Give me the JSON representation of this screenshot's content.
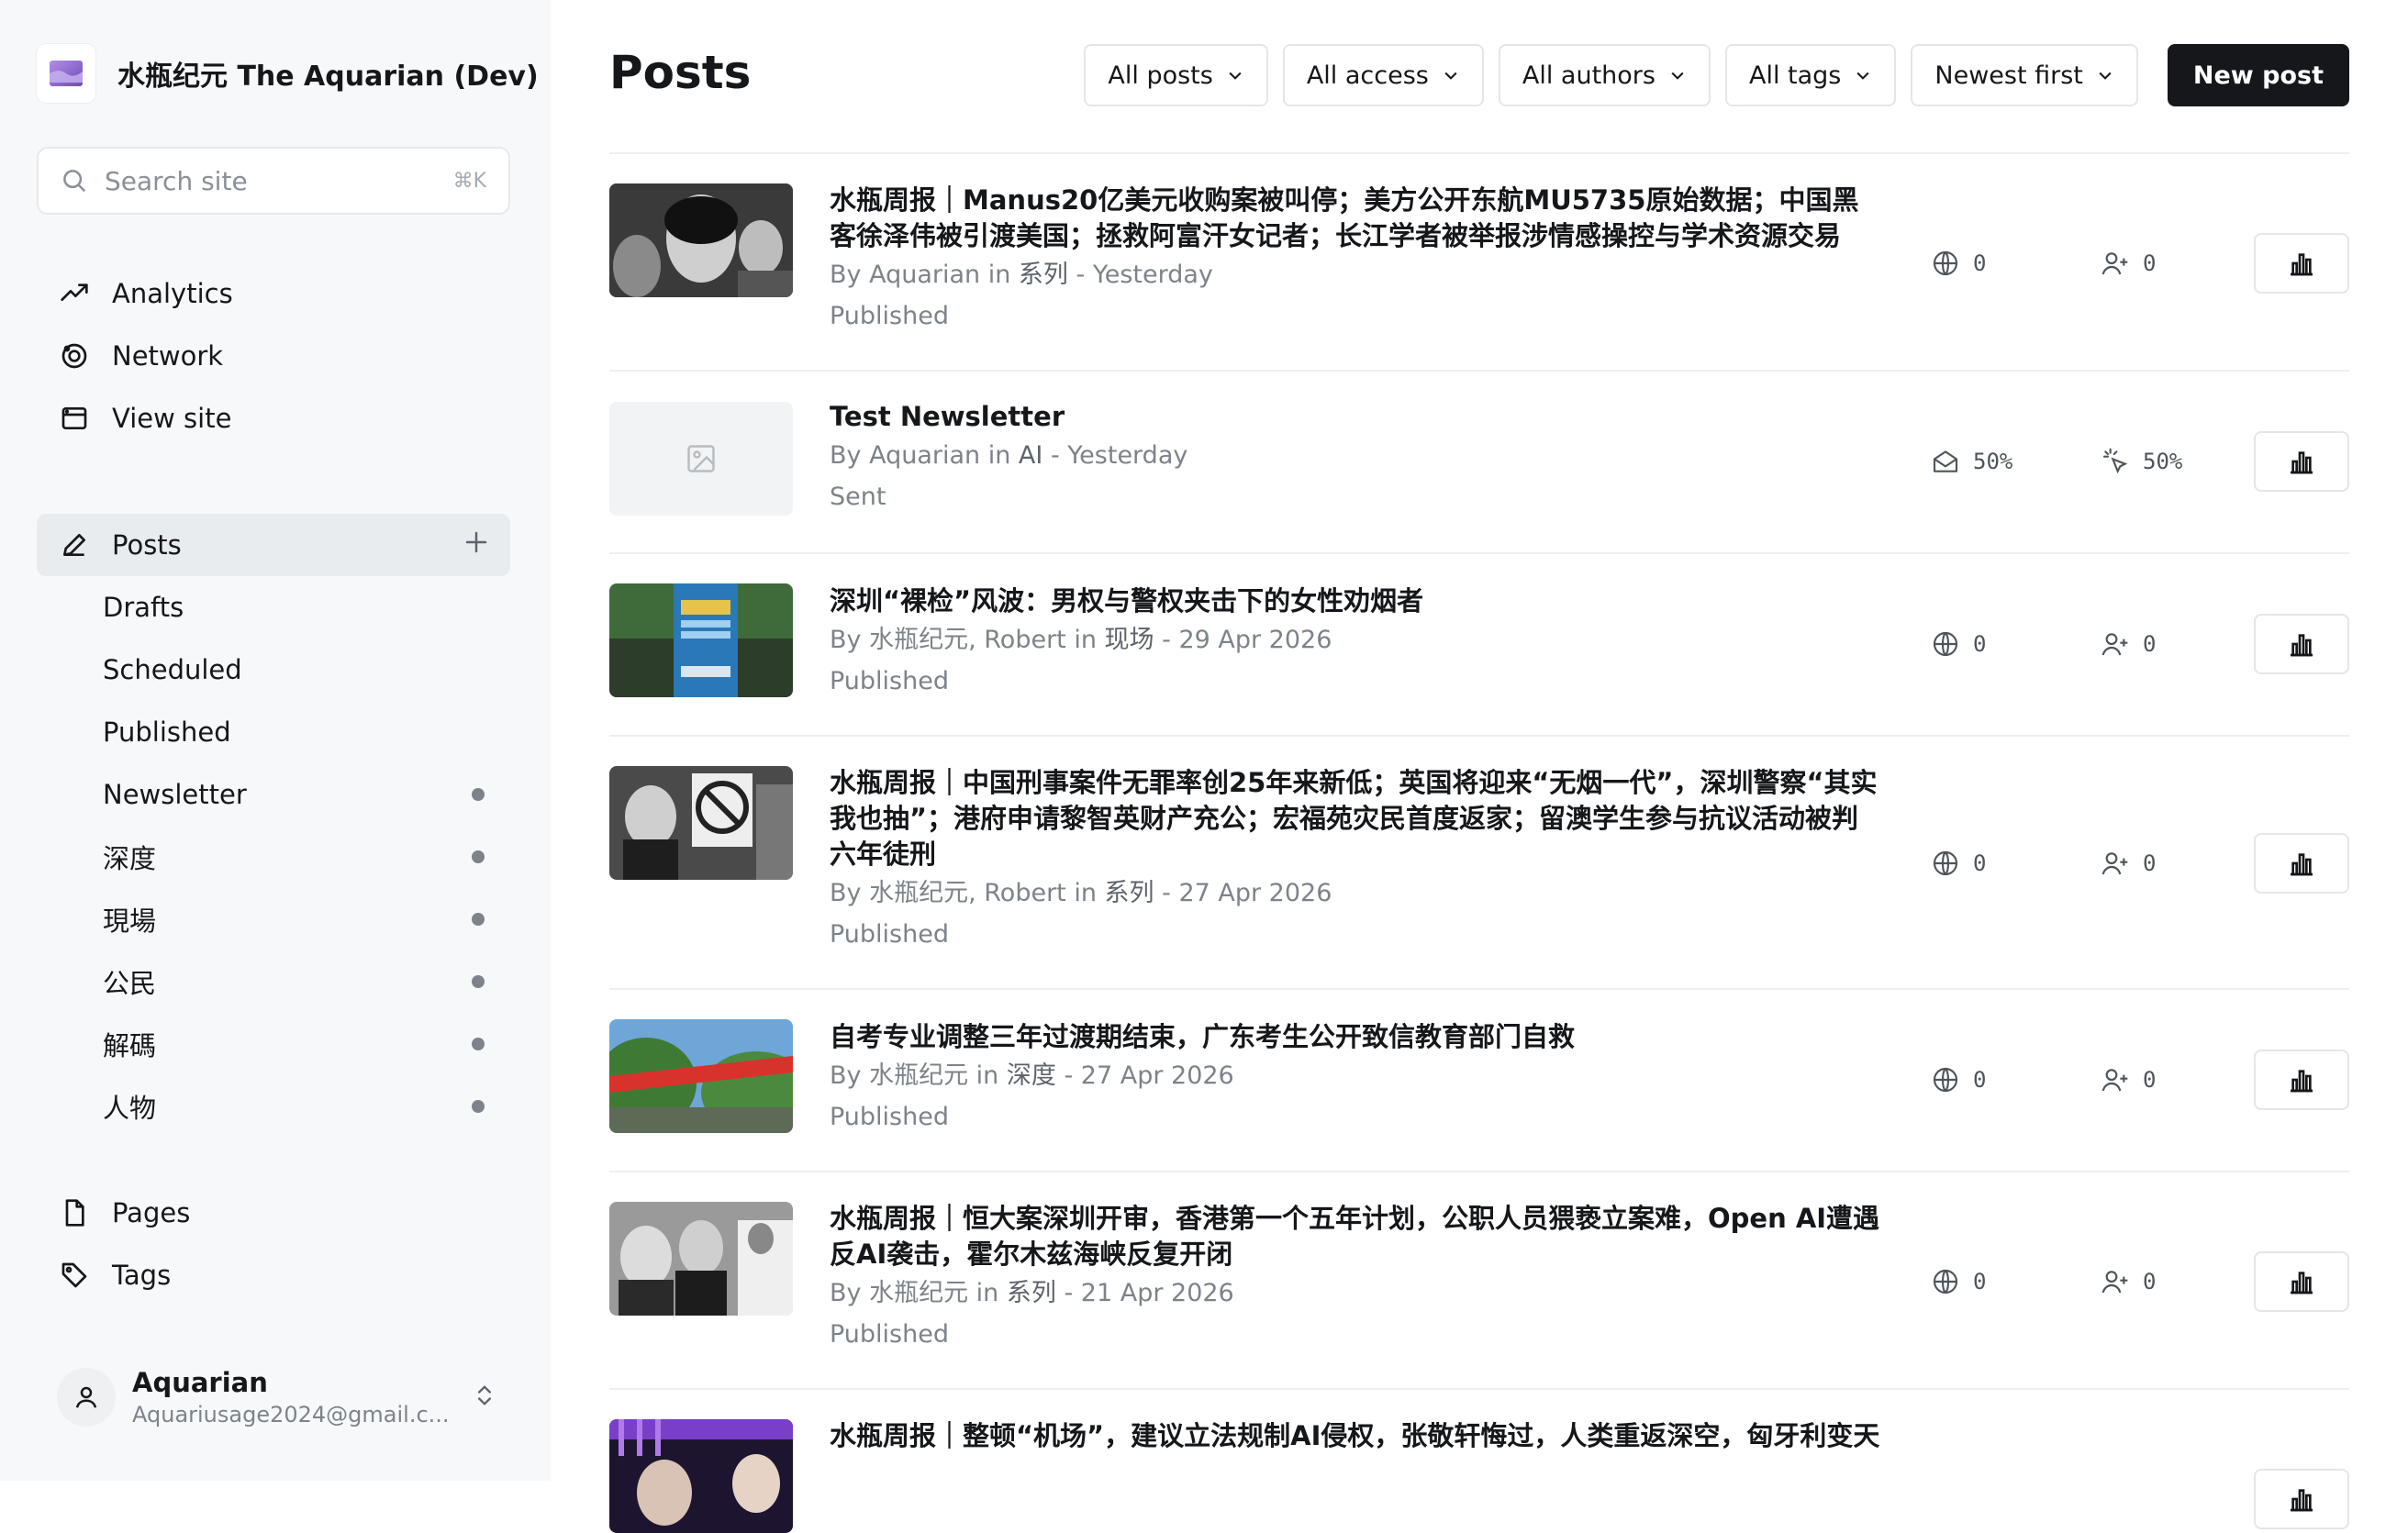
{
  "sidebar": {
    "site_title": "水瓶纪元 The Aquarian (Dev)",
    "search": {
      "placeholder": "Search site",
      "shortcut": "⌘K"
    },
    "nav": [
      {
        "label": "Analytics",
        "icon": "trend-up-icon"
      },
      {
        "label": "Network",
        "icon": "network-icon"
      },
      {
        "label": "View site",
        "icon": "browser-icon"
      }
    ],
    "posts": {
      "label": "Posts",
      "icon": "pen-icon",
      "add_icon": "plus-icon"
    },
    "post_subitems": [
      {
        "label": "Drafts",
        "dot": false
      },
      {
        "label": "Scheduled",
        "dot": false
      },
      {
        "label": "Published",
        "dot": false
      },
      {
        "label": "Newsletter",
        "dot": true
      },
      {
        "label": "深度",
        "dot": true
      },
      {
        "label": "現場",
        "dot": true
      },
      {
        "label": "公民",
        "dot": true
      },
      {
        "label": "解碼",
        "dot": true
      },
      {
        "label": "人物",
        "dot": true
      }
    ],
    "nav2": [
      {
        "label": "Pages",
        "icon": "page-icon"
      },
      {
        "label": "Tags",
        "icon": "tag-icon"
      }
    ],
    "user": {
      "name": "Aquarian",
      "email": "Aquariusage2024@gmail.c..."
    }
  },
  "main": {
    "title": "Posts",
    "filters": [
      "All posts",
      "All access",
      "All authors",
      "All tags",
      "Newest first"
    ],
    "new_post_label": "New post",
    "posts": [
      {
        "title": "水瓶周报｜Manus20亿美元收购案被叫停；美方公开东航MU5735原始数据；中国黑客徐泽伟被引渡美国；拯救阿富汗女记者；长江学者被举报涉情感操控与学术资源交易",
        "by": "By Aquarian in ",
        "tag": "系列",
        "date": " - Yesterday",
        "status": "Published",
        "stat1": "0",
        "stat2": "0",
        "kind": "web",
        "thumb": "bw-faces"
      },
      {
        "title": "Test Newsletter",
        "by": "By Aquarian in ",
        "tag": "AI",
        "date": " - Yesterday",
        "status": "Sent",
        "stat1": "50%",
        "stat2": "50%",
        "kind": "email",
        "thumb": "placeholder"
      },
      {
        "title": "深圳“裸检”风波：男权与警权夹击下的女性劝烟者",
        "by": "By 水瓶纪元, Robert in ",
        "tag": "现场",
        "date": " - 29 Apr 2026",
        "status": "Published",
        "stat1": "0",
        "stat2": "0",
        "kind": "web",
        "thumb": "blue-sign"
      },
      {
        "title": "水瓶周报｜中国刑事案件无罪率创25年来新低；英国将迎来“无烟一代”，深圳警察“其实我也抽”；港府申请黎智英财产充公；宏福苑灾民首度返家；留澳学生参与抗议活动被判六年徒刑",
        "by": "By 水瓶纪元, Robert in ",
        "tag": "系列",
        "date": " - 27 Apr 2026",
        "status": "Published",
        "stat1": "0",
        "stat2": "0",
        "kind": "web",
        "thumb": "bw-nosmoking"
      },
      {
        "title": "自考专业调整三年过渡期结束，广东考生公开致信教育部门自救",
        "by": "By 水瓶纪元 in ",
        "tag": "深度",
        "date": " - 27 Apr 2026",
        "status": "Published",
        "stat1": "0",
        "stat2": "0",
        "kind": "web",
        "thumb": "banner-trees"
      },
      {
        "title": "水瓶周报｜恒大案深圳开审，香港第一个五年计划，公职人员猥亵立案难，Open AI遭遇反AI袭击，霍尔木兹海峡反复开闭",
        "by": "By 水瓶纪元 in ",
        "tag": "系列",
        "date": " - 21 Apr 2026",
        "status": "Published",
        "stat1": "0",
        "stat2": "0",
        "kind": "web",
        "thumb": "bw-podium"
      },
      {
        "title": "水瓶周报｜整顿“机场”，建议立法规制AI侵权，张敬轩悔过，人类重返深空，匈牙利变天",
        "by": "",
        "tag": "",
        "date": "",
        "status": "",
        "stat1": "",
        "stat2": "",
        "kind": "web",
        "thumb": "purple-stage"
      }
    ]
  },
  "colors": {
    "brand_purple": "#8e6fd0",
    "primary_dark": "#15171a",
    "muted": "#7d838a",
    "border": "#eceef0"
  }
}
